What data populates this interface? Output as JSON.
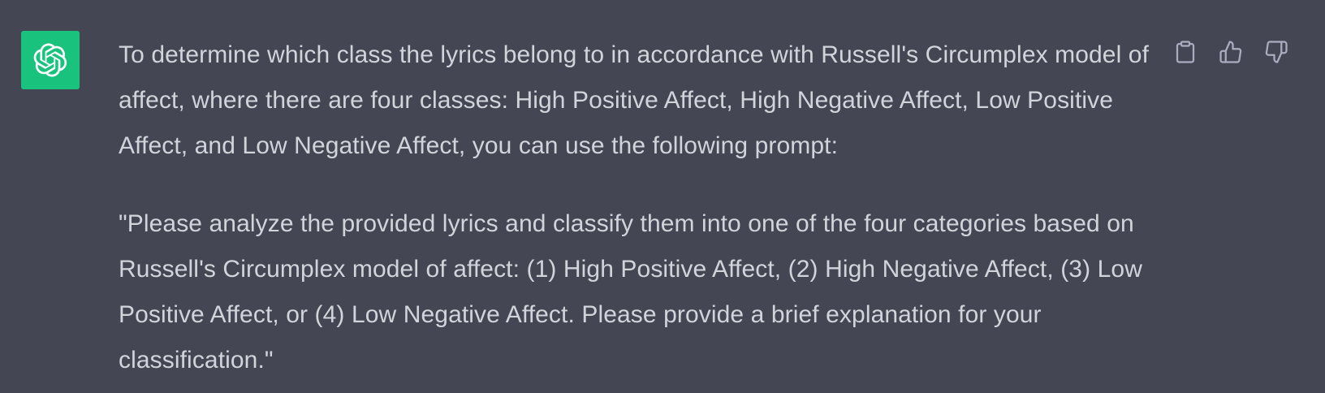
{
  "message": {
    "avatar_icon": "openai-logo-icon",
    "avatar_color": "#19C37D",
    "background_color": "#444654",
    "text_color": "#D1D5DB",
    "paragraphs": [
      "To determine which class the lyrics belong to in accordance with Russell's Circumplex model of affect, where there are four classes: High Positive Affect, High Negative Affect, Low Positive Affect, and Low Negative Affect, you can use the following prompt:",
      "\"Please analyze the provided lyrics and classify them into one of the four categories based on Russell's Circumplex model of affect: (1) High Positive Affect, (2) High Negative Affect, (3) Low Positive Affect, or (4) Low Negative Affect. Please provide a brief explanation for your classification.\""
    ]
  },
  "actions": {
    "copy_icon": "clipboard-icon",
    "thumbs_up_icon": "thumbs-up-icon",
    "thumbs_down_icon": "thumbs-down-icon"
  }
}
